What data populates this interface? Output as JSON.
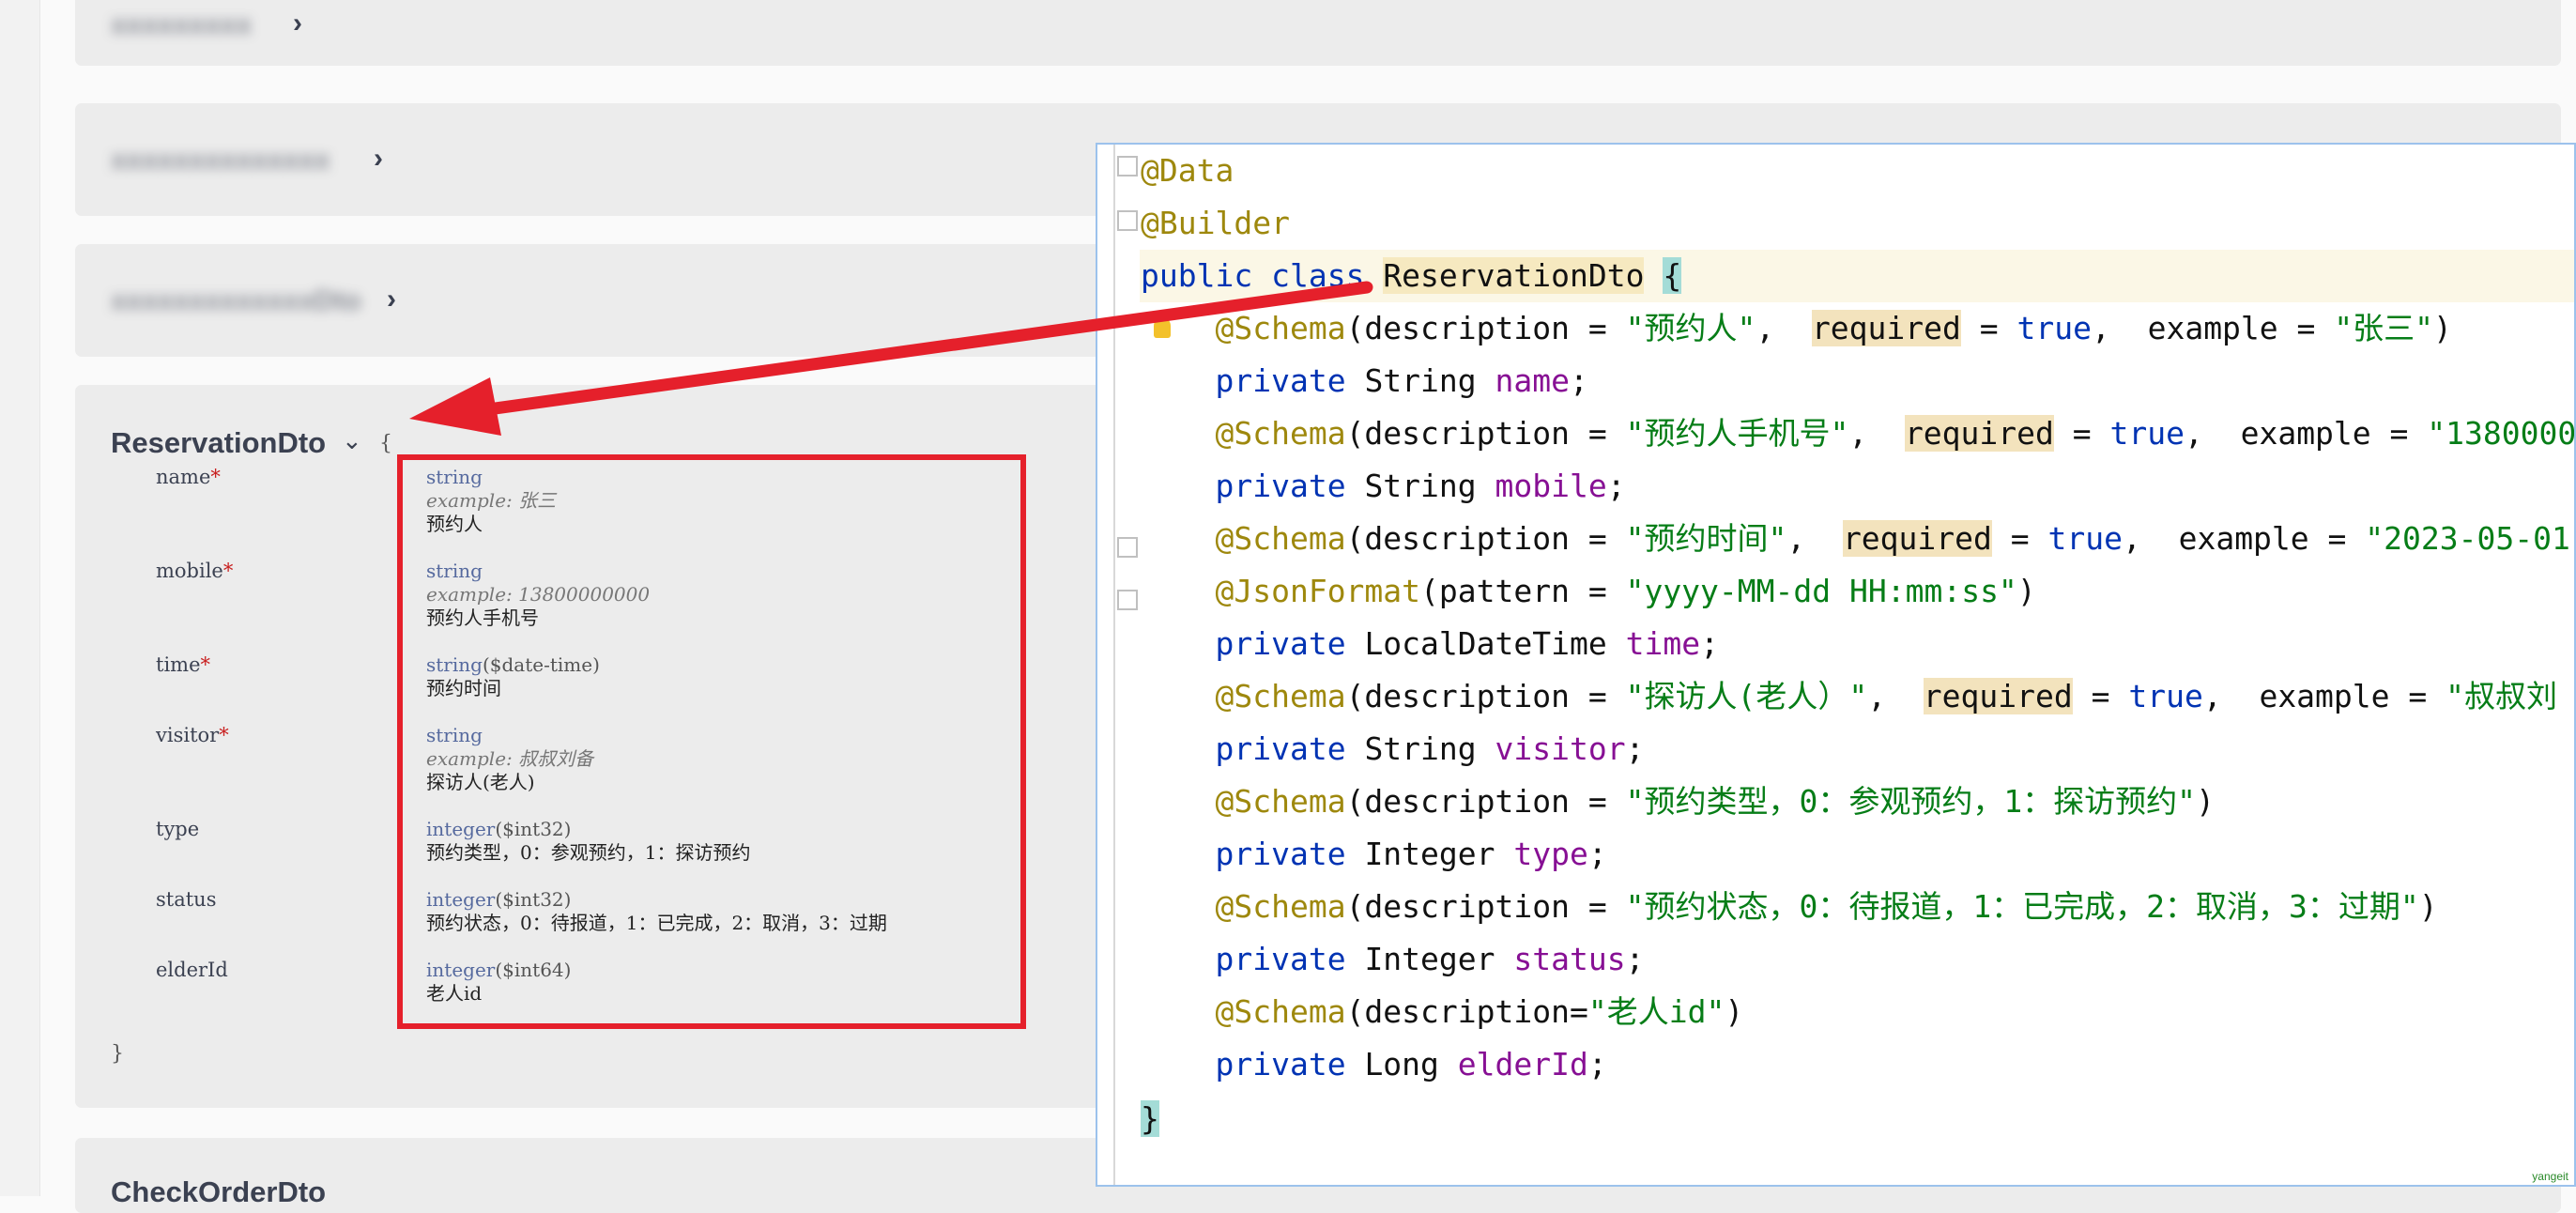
{
  "swagger": {
    "collapsed_models_top": [
      {
        "title": "xxxxxxxxx"
      },
      {
        "title": "xxxxxxxxxxxxxx"
      },
      {
        "title": "xxxxxxxxxxxxxDto"
      }
    ],
    "open_model": {
      "name": "ReservationDto",
      "open_brace": "{",
      "close_brace": "}",
      "properties": [
        {
          "name": "name",
          "required": "*",
          "type": "string",
          "format": "",
          "example": "example: 张三",
          "description": "预约人"
        },
        {
          "name": "mobile",
          "required": "*",
          "type": "string",
          "format": "",
          "example": "example: 13800000000",
          "description": "预约人手机号"
        },
        {
          "name": "time",
          "required": "*",
          "type": "string",
          "format": "($date-time)",
          "example": "",
          "description": "预约时间"
        },
        {
          "name": "visitor",
          "required": "*",
          "type": "string",
          "format": "",
          "example": "example: 叔叔刘备",
          "description": "探访人(老人)"
        },
        {
          "name": "type",
          "required": "",
          "type": "integer",
          "format": "($int32)",
          "example": "",
          "description": "预约类型，0：参观预约，1：探访预约"
        },
        {
          "name": "status",
          "required": "",
          "type": "integer",
          "format": "($int32)",
          "example": "",
          "description": "预约状态，0：待报道，1：已完成，2：取消，3：过期"
        },
        {
          "name": "elderId",
          "required": "",
          "type": "integer",
          "format": "($int64)",
          "example": "",
          "description": "老人id"
        }
      ]
    },
    "collapsed_models_bottom": [
      {
        "title": "CheckOrderDto"
      }
    ]
  },
  "code": {
    "l1": {
      "a": "@Data"
    },
    "l2": {
      "a": "@Builder"
    },
    "l3": {
      "kw1": "public",
      "kw2": "class",
      "cls": "ReservationDto",
      "brace": "{"
    },
    "l4": {
      "a": "@Schema",
      "p1": "(description = ",
      "s1": "\"预约人\"",
      "p2": ",  ",
      "req": "required",
      "p3": " = ",
      "t": "true",
      "p4": ",  example = ",
      "s2": "\"张三\"",
      "p5": ")"
    },
    "l5": {
      "kw": "private",
      "type": "String",
      "fld": "name",
      "end": ";"
    },
    "l6": {
      "a": "@Schema",
      "p1": "(description = ",
      "s1": "\"预约人手机号\"",
      "p2": ",  ",
      "req": "required",
      "p3": " = ",
      "t": "true",
      "p4": ",  example = ",
      "s2": "\"1380000"
    },
    "l7": {
      "kw": "private",
      "type": "String",
      "fld": "mobile",
      "end": ";"
    },
    "l8": {
      "a": "@Schema",
      "p1": "(description = ",
      "s1": "\"预约时间\"",
      "p2": ",  ",
      "req": "required",
      "p3": " = ",
      "t": "true",
      "p4": ",  example = ",
      "s2": "\"2023-05-01"
    },
    "l9": {
      "a": "@JsonFormat",
      "p1": "(pattern = ",
      "s1": "\"yyyy-MM-dd HH:mm:ss\"",
      "p2": ")"
    },
    "l10": {
      "kw": "private",
      "type": "LocalDateTime",
      "fld": "time",
      "end": ";"
    },
    "l11": {
      "a": "@Schema",
      "p1": "(description = ",
      "s1": "\"探访人(老人）\"",
      "p2": ",  ",
      "req": "required",
      "p3": " = ",
      "t": "true",
      "p4": ",  example = ",
      "s2": "\"叔叔刘"
    },
    "l12": {
      "kw": "private",
      "type": "String",
      "fld": "visitor",
      "end": ";"
    },
    "l13": {
      "a": "@Schema",
      "p1": "(description = ",
      "s1": "\"预约类型，0：参观预约，1：探访预约\"",
      "p2": ")"
    },
    "l14": {
      "kw": "private",
      "type": "Integer",
      "fld": "type",
      "end": ";"
    },
    "l15": {
      "a": "@Schema",
      "p1": "(description = ",
      "s1": "\"预约状态，0：待报道，1：已完成，2：取消，3：过期\"",
      "p2": ")"
    },
    "l16": {
      "kw": "private",
      "type": "Integer",
      "fld": "status",
      "end": ";"
    },
    "l17": {
      "a": "@Schema",
      "p1": "(description=",
      "s1": "\"老人id\"",
      "p2": ")"
    },
    "l18": {
      "kw": "private",
      "type": "Long",
      "fld": "elderId",
      "end": ";"
    },
    "l19": {
      "brace": "}"
    }
  },
  "watermark": "yangeit",
  "colors": {
    "annotation_red": "#e5202b",
    "ide_border": "#9cc2ec",
    "card_bg": "#ececec"
  }
}
